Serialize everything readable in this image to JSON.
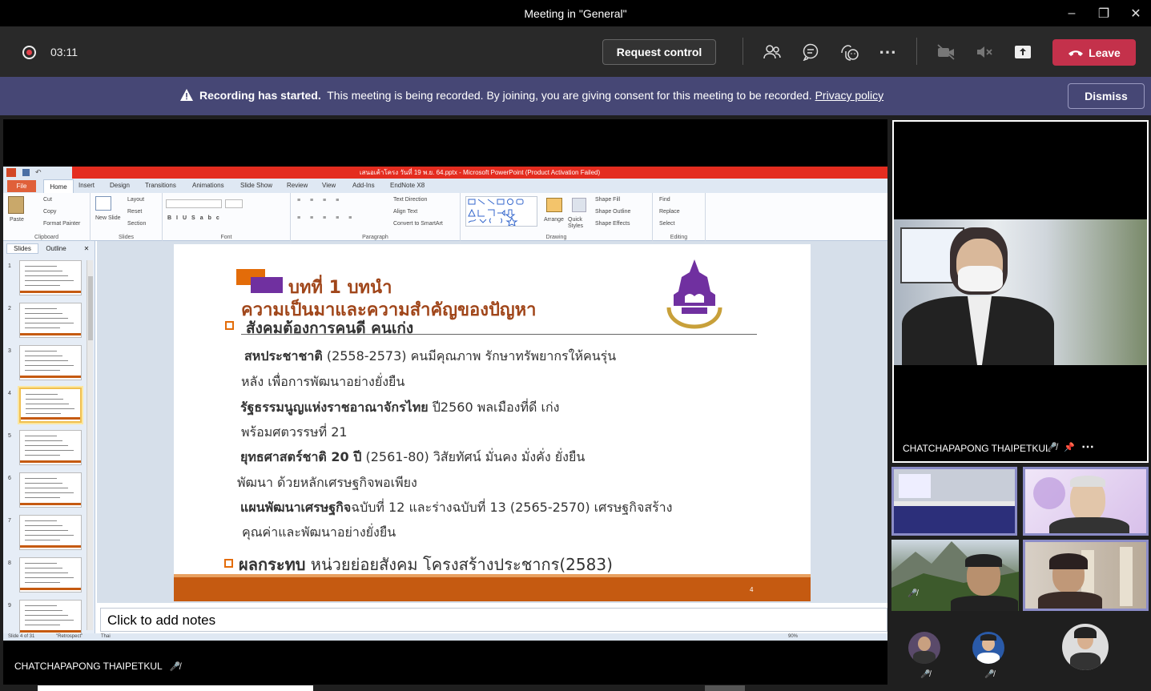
{
  "window": {
    "title": "Meeting in \"General\""
  },
  "toolbar": {
    "timer": "03:11",
    "request_control": "Request control",
    "leave_label": "Leave"
  },
  "banner": {
    "bold": "Recording has started.",
    "text": "This meeting is being recorded. By joining, you are giving consent for this meeting to be recorded.",
    "link": "Privacy policy",
    "dismiss": "Dismiss"
  },
  "ppt": {
    "title": "เสนอเค้าโครง วันที่ 19 พ.ย. 64.pptx - Microsoft PowerPoint (Product Activation Failed)",
    "tabs": [
      "File",
      "Home",
      "Insert",
      "Design",
      "Transitions",
      "Animations",
      "Slide Show",
      "Review",
      "View",
      "Add-Ins",
      "EndNote X8"
    ],
    "groups": {
      "clipboard": "Clipboard",
      "slides": "Slides",
      "font": "Font",
      "paragraph": "Paragraph",
      "drawing": "Drawing",
      "editing": "Editing"
    },
    "ribbon_items": {
      "paste": "Paste",
      "cut": "Cut",
      "copy": "Copy",
      "format_painter": "Format Painter",
      "new_slide": "New Slide",
      "layout": "Layout",
      "reset": "Reset",
      "section": "Section",
      "text_direction": "Text Direction",
      "align_text": "Align Text",
      "convert_smartart": "Convert to SmartArt",
      "arrange": "Arrange",
      "quick_styles": "Quick Styles",
      "shape_fill": "Shape Fill",
      "shape_outline": "Shape Outline",
      "shape_effects": "Shape Effects",
      "find": "Find",
      "replace": "Replace",
      "select": "Select"
    },
    "panel_tabs": [
      "Slides",
      "Outline"
    ],
    "thumb_numbers": [
      "1",
      "2",
      "3",
      "4",
      "5",
      "6",
      "7",
      "8",
      "9"
    ],
    "notes_placeholder": "Click to add notes",
    "status": {
      "slide": "Slide 4 of 31",
      "theme": "\"Retrospect\"",
      "lang": "Thai",
      "zoom": "90%"
    }
  },
  "slide": {
    "heading1": "บทที่ 1 บทนำ",
    "heading2": "ความเป็นมาและความสำคัญของปัญหา",
    "heading3": "สังคมต้องการคนดี คนเก่ง",
    "lines": [
      {
        "bold": "สหประชาชาติ",
        "rest": " (2558-2573) คนมีคุณภาพ รักษาทรัพยากรให้คนรุ่น"
      },
      {
        "bold": "",
        "rest": "หลัง เพื่อการพัฒนาอย่างยั่งยืน"
      },
      {
        "bold": "รัฐธรรมนูญแห่งราชอาณาจักรไทย",
        "rest": " ปี2560 พลเมืองที่ดี เก่ง"
      },
      {
        "bold": "",
        "rest": "พร้อมศตวรรษที่ 21"
      },
      {
        "bold": "ยุทธศาสตร์ชาติ 20 ปี",
        "rest": " (2561-80) วิสัยทัศน์ มั่นคง มั่งคั่ง ยั่งยืน"
      },
      {
        "bold": "",
        "rest": "พัฒนา ด้วยหลักเศรษฐกิจพอเพียง"
      },
      {
        "bold": "แผนพัฒนาเศรษฐกิจ",
        "rest": "ฉบับที่ 12 และร่างฉบับที่ 13 (2565-2570) เศรษฐกิจสร้าง"
      },
      {
        "bold": "",
        "rest": "คุณค่าและพัฒนาอย่างยั่งยืน"
      }
    ],
    "bottom_bold": "ผลกระทบ",
    "bottom_rest": " หน่วยย่อยสังคม โครงสร้างประชากร(2583)",
    "page_number": "4"
  },
  "presenter": {
    "name": "CHATCHAPAPONG THAIPETKUL"
  },
  "main_video": {
    "name": "CHATCHAPAPONG THAIPETKUL"
  },
  "colors": {
    "accent": "#464775",
    "leave": "#c4314b",
    "slide_orange": "#c55a11",
    "slide_purple": "#7030a0"
  }
}
